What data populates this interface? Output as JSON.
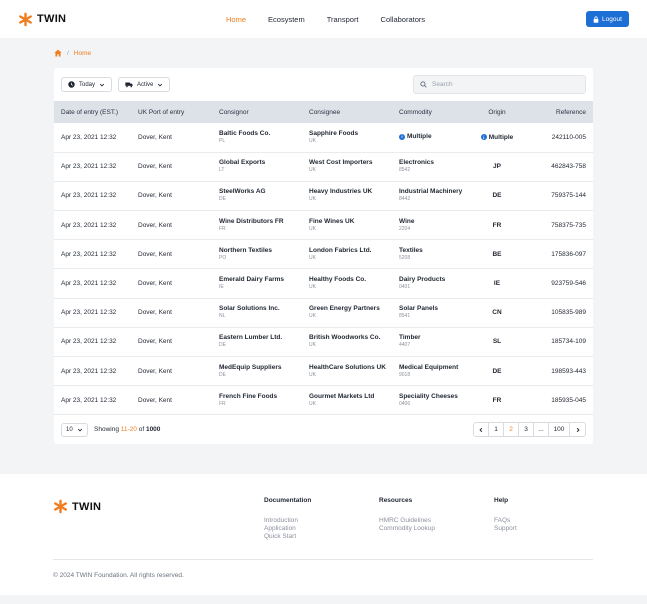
{
  "header": {
    "logo_text": "TWIN",
    "nav": [
      {
        "label": "Home",
        "active": true
      },
      {
        "label": "Ecosystem",
        "active": false
      },
      {
        "label": "Transport",
        "active": false
      },
      {
        "label": "Collaborators",
        "active": false
      }
    ],
    "logout_label": "Logout"
  },
  "breadcrumb": {
    "current": "Home"
  },
  "filters": {
    "date_label": "Today",
    "status_label": "Active",
    "search_placeholder": "Search"
  },
  "table": {
    "columns": [
      "Date of entry (EST.)",
      "UK Port of entry",
      "Consignor",
      "Consignee",
      "Commodity",
      "Origin",
      "Reference"
    ],
    "rows": [
      {
        "date": "Apr 23, 2021 12:32",
        "port": "Dover, Kent",
        "consignor": "Baltic Foods Co.",
        "consignor_cc": "PL",
        "consignee": "Sapphire Foods",
        "consignee_cc": "UK",
        "commodity": "Multiple",
        "commodity_code": "",
        "origin": "Multiple",
        "reference": "242110-005"
      },
      {
        "date": "Apr 23, 2021 12:32",
        "port": "Dover, Kent",
        "consignor": "Global Exports",
        "consignor_cc": "LT",
        "consignee": "West Cost Importers",
        "consignee_cc": "UK",
        "commodity": "Electronics",
        "commodity_code": "8542",
        "origin": "JP",
        "reference": "462843-758"
      },
      {
        "date": "Apr 23, 2021 12:32",
        "port": "Dover, Kent",
        "consignor": "SteelWorks AG",
        "consignor_cc": "DE",
        "consignee": "Heavy Industries UK",
        "consignee_cc": "UK",
        "commodity": "Industrial Machinery",
        "commodity_code": "8442",
        "origin": "DE",
        "reference": "759375-144"
      },
      {
        "date": "Apr 23, 2021 12:32",
        "port": "Dover, Kent",
        "consignor": "Wine Distributors FR",
        "consignor_cc": "FR",
        "consignee": "Fine Wines UK",
        "consignee_cc": "UK",
        "commodity": "Wine",
        "commodity_code": "2204",
        "origin": "FR",
        "reference": "758375-735"
      },
      {
        "date": "Apr 23, 2021 12:32",
        "port": "Dover, Kent",
        "consignor": "Northern Textiles",
        "consignor_cc": "PO",
        "consignee": "London Fabrics Ltd.",
        "consignee_cc": "UK",
        "commodity": "Textiles",
        "commodity_code": "5208",
        "origin": "BE",
        "reference": "175836-097"
      },
      {
        "date": "Apr 23, 2021 12:32",
        "port": "Dover, Kent",
        "consignor": "Emerald Dairy Farms",
        "consignor_cc": "IE",
        "consignee": "Healthy Foods Co.",
        "consignee_cc": "UK",
        "commodity": "Dairy Products",
        "commodity_code": "0401",
        "origin": "IE",
        "reference": "923759-546"
      },
      {
        "date": "Apr 23, 2021 12:32",
        "port": "Dover, Kent",
        "consignor": "Solar Solutions Inc.",
        "consignor_cc": "NL",
        "consignee": "Green Energy Partners",
        "consignee_cc": "UK",
        "commodity": "Solar Panels",
        "commodity_code": "8541",
        "origin": "CN",
        "reference": "105835-989"
      },
      {
        "date": "Apr 23, 2021 12:32",
        "port": "Dover, Kent",
        "consignor": "Eastern Lumber Ltd.",
        "consignor_cc": "DE",
        "consignee": "British Woodworks Co.",
        "consignee_cc": "UK",
        "commodity": "Timber",
        "commodity_code": "4407",
        "origin": "SL",
        "reference": "185734-109"
      },
      {
        "date": "Apr 23, 2021 12:32",
        "port": "Dover, Kent",
        "consignor": "MedEquip Suppliers",
        "consignor_cc": "DE",
        "consignee": "HealthCare Solutions UK",
        "consignee_cc": "UK",
        "commodity": "Medical Equipment",
        "commodity_code": "9018",
        "origin": "DE",
        "reference": "198593-443"
      },
      {
        "date": "Apr 23, 2021 12:32",
        "port": "Dover, Kent",
        "consignor": "French Fine Foods",
        "consignor_cc": "FR",
        "consignee": "Gourmet Markets Ltd",
        "consignee_cc": "UK",
        "commodity": "Speciality Cheeses",
        "commodity_code": "0406",
        "origin": "FR",
        "reference": "185935-045"
      }
    ]
  },
  "pagination": {
    "page_size": "10",
    "showing_prefix": "Showing",
    "range": "11-20",
    "of_label": "of",
    "total": "1000",
    "pages": [
      "1",
      "2",
      "3",
      "...",
      "100"
    ],
    "current_page": "2"
  },
  "footer": {
    "logo_text": "TWIN",
    "columns": [
      {
        "title": "Documentation",
        "links": [
          "Introduction",
          "Application",
          "Quick Start"
        ]
      },
      {
        "title": "Resources",
        "links": [
          "HMRC Guidelines",
          "Commodity Lookup"
        ]
      },
      {
        "title": "Help",
        "links": [
          "FAQs",
          "Support"
        ]
      }
    ],
    "copyright": "© 2024 TWIN Foundation. All rights reserved."
  },
  "colors": {
    "accent": "#f07d1f",
    "primary": "#1d6fd6",
    "header_row": "#dde1e8"
  },
  "icons": [
    "twin-logo-icon",
    "home-icon",
    "clock-icon",
    "truck-icon",
    "chevron-down-icon",
    "search-icon",
    "lock-icon",
    "info-icon",
    "chevron-left-icon",
    "chevron-right-icon"
  ]
}
